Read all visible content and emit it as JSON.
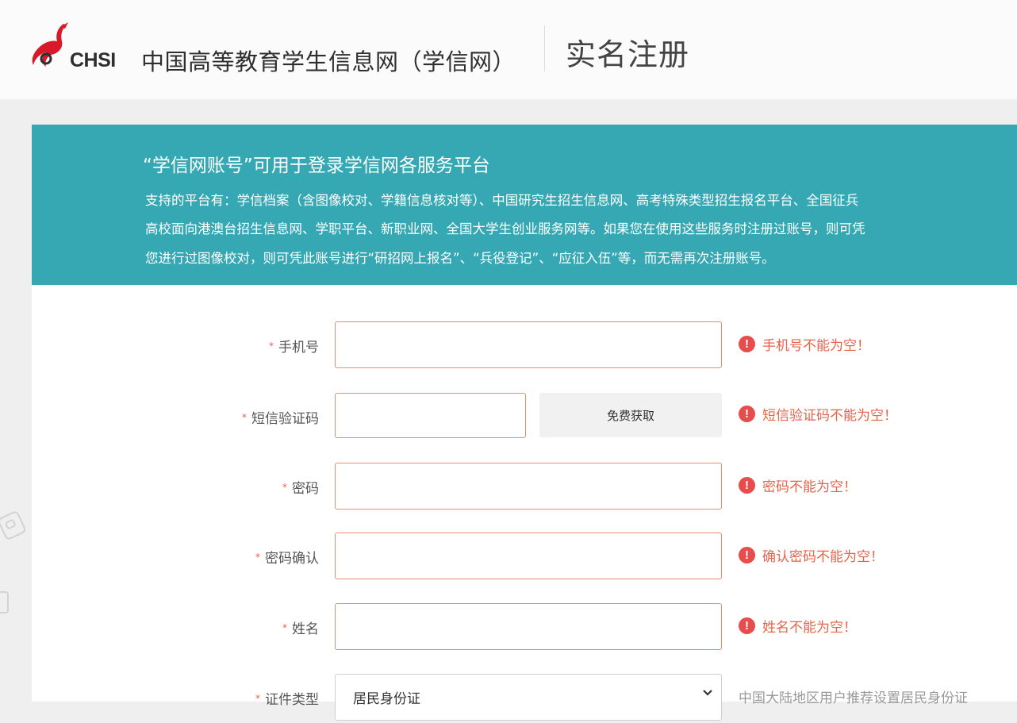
{
  "header": {
    "logo_text": "CHSI",
    "site_name": "中国高等教育学生信息网（学信网）",
    "page_title": "实名注册"
  },
  "banner": {
    "title": "“学信网账号”可用于登录学信网各服务平台",
    "line1": "支持的平台有：学信档案（含图像校对、学籍信息核对等）、中国研究生招生信息网、高考特殊类型招生报名平台、全国征兵",
    "line2": "高校面向港澳台招生信息网、学职平台、新职业网、全国大学生创业服务网等。如果您在使用这些服务时注册过账号，则可凭",
    "line3": "您进行过图像校对，则可凭此账号进行“研招网上报名”、“兵役登记”、“应征入伍”等，而无需再次注册账号。"
  },
  "form": {
    "required_mark": "*",
    "phone": {
      "label": "手机号",
      "value": "",
      "error": "手机号不能为空！"
    },
    "sms": {
      "label": "短信验证码",
      "value": "",
      "button": "免费获取",
      "error": "短信验证码不能为空！"
    },
    "password": {
      "label": "密码",
      "value": "",
      "error": "密码不能为空！"
    },
    "password_confirm": {
      "label": "密码确认",
      "value": "",
      "error": "确认密码不能为空！"
    },
    "name": {
      "label": "姓名",
      "value": "",
      "error": "姓名不能为空！"
    },
    "id_type": {
      "label": "证件类型",
      "selected": "居民身份证",
      "hint": "中国大陆地区用户推荐设置居民身份证"
    },
    "error_icon": "!"
  },
  "colors": {
    "banner": "#35a8b3",
    "error": "#e4644a",
    "input_border_error": "#ec8a6e",
    "logo_red": "#d7192a"
  },
  "icons": [
    "chsi-logo",
    "exclamation-circle-icon",
    "chevron-down-icon"
  ]
}
